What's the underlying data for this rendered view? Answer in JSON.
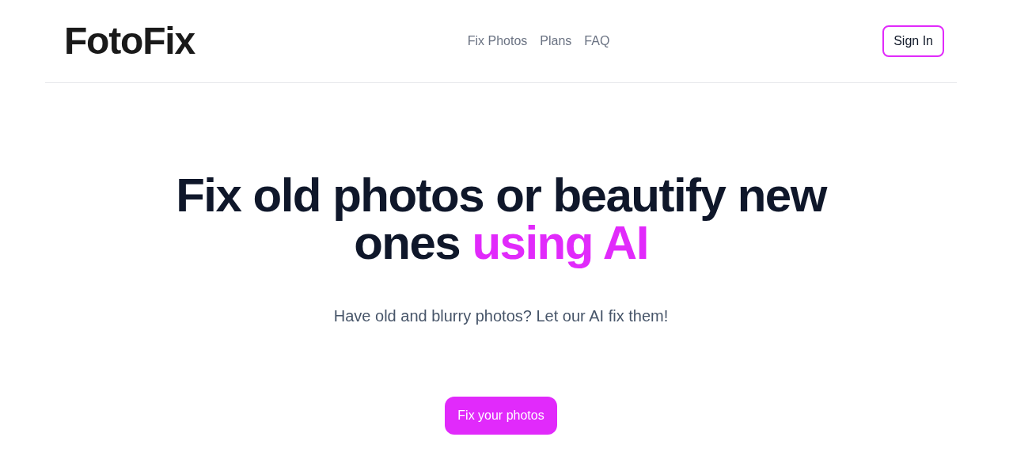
{
  "header": {
    "logo": "FotoFix",
    "nav": [
      "Fix Photos",
      "Plans",
      "FAQ"
    ],
    "sign_in_button": "Sign In"
  },
  "hero": {
    "heading": "Fix old photos or beautify new ones",
    "heading_highlight": "using AI",
    "subtitle": "Have old and blurry photos? Let our AI fix them!",
    "cta_button": "Fix your photos"
  }
}
